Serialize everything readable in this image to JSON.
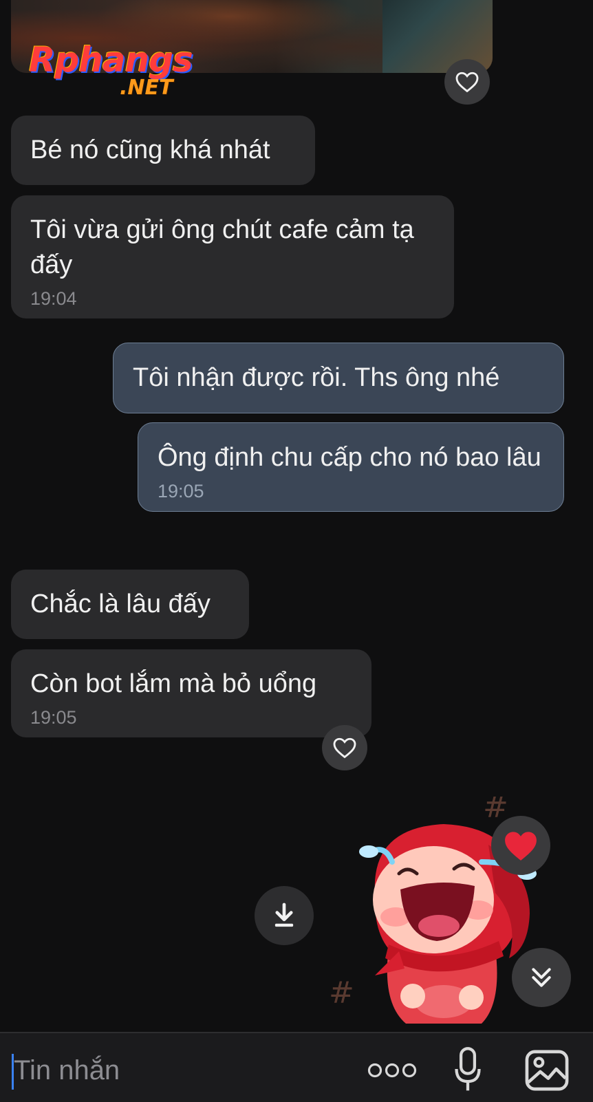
{
  "watermark": {
    "main": "Rphangs",
    "sub": ".NET"
  },
  "messages": [
    {
      "text": "Bé nó cũng khá nhát"
    },
    {
      "text": "Tôi vừa gửi ông chút cafe cảm tạ đấy",
      "time": "19:04"
    },
    {
      "text": "Tôi nhận được rồi. Ths ông nhé"
    },
    {
      "text": "Ông định chu cấp cho nó bao lâu",
      "time": "19:05"
    },
    {
      "text": "Chắc là lâu đấy"
    },
    {
      "text": "Còn bot lắm mà bỏ uổng",
      "time": "19:05"
    }
  ],
  "composer": {
    "placeholder": "Tin nhắn"
  },
  "icons": {
    "like": "heart-outline-icon",
    "reaction": "red-heart-icon",
    "download": "download-icon",
    "scroll": "double-chevron-down-icon",
    "more": "more-dots-icon",
    "mic": "microphone-icon",
    "image": "image-icon"
  },
  "colors": {
    "incoming_bubble": "#2a2a2c",
    "outgoing_bubble": "#3b4656",
    "accent": "#3a82f7",
    "heart": "#e8263a"
  }
}
